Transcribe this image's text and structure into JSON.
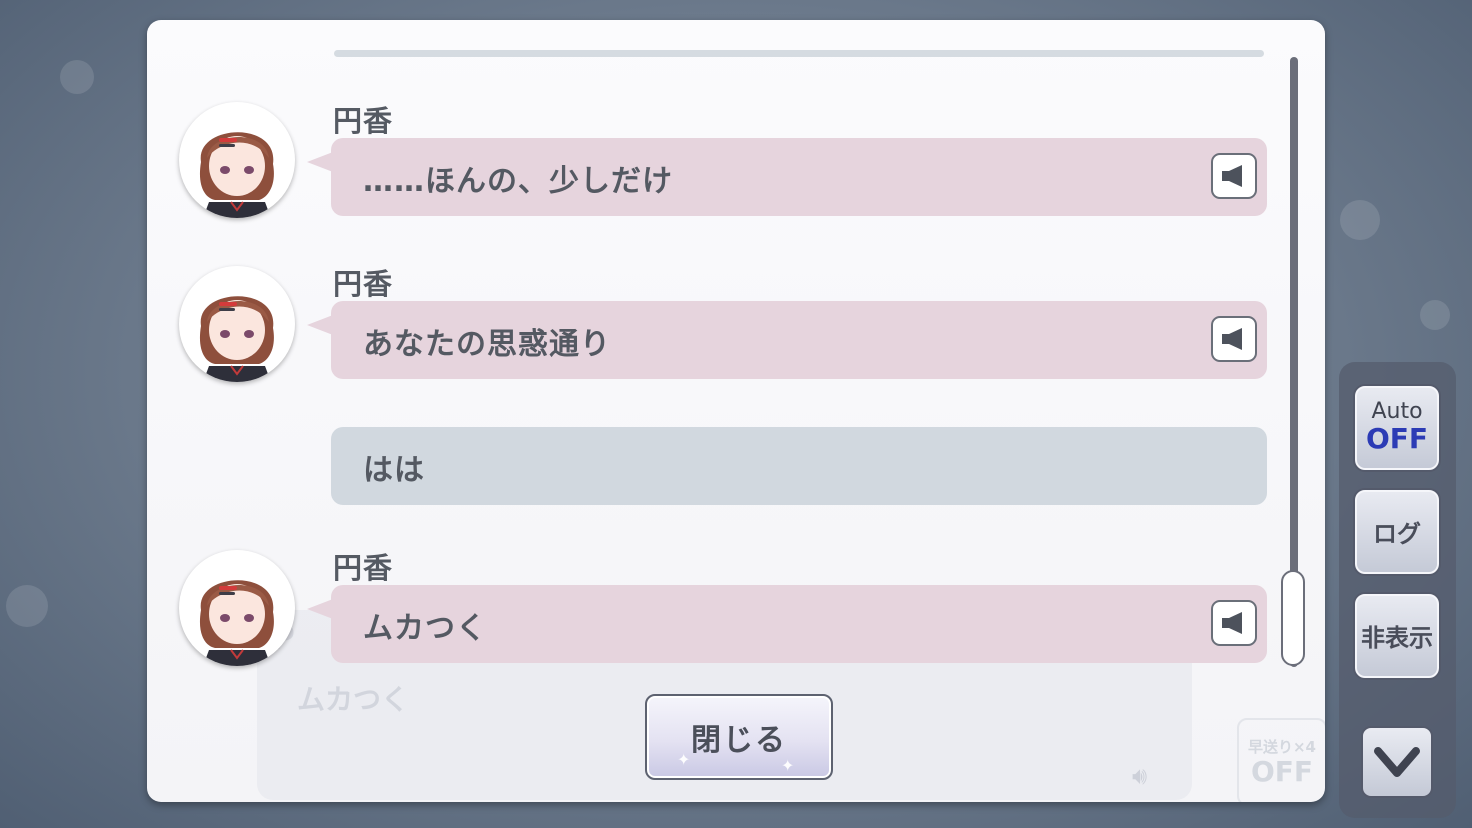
{
  "log": {
    "entries": [
      {
        "speaker": "円香",
        "text": "……ほんの、少しだけ",
        "has_voice": true,
        "avatar_icon": "madoka-avatar-icon"
      },
      {
        "speaker": "円香",
        "text": "あなたの思惑通り",
        "has_voice": true,
        "avatar_icon": "madoka-avatar-icon"
      },
      {
        "speaker": "",
        "text": "はは",
        "has_voice": false
      },
      {
        "speaker": "円香",
        "text": "ムカつく",
        "has_voice": true,
        "avatar_icon": "madoka-avatar-icon"
      }
    ],
    "close_label": "閉じる",
    "voice_icon": "speaker-icon"
  },
  "background_dialog": {
    "line": "ムカつく",
    "fast_forward_top": "早送り×4",
    "fast_forward_bottom": "OFF"
  },
  "side_controls": {
    "auto_top": "Auto",
    "auto_bottom": "OFF",
    "log_label": "ログ",
    "hide_label": "非表示",
    "down_icon": "chevron-down-icon"
  },
  "colors": {
    "character_bubble": "#e6d4dd",
    "protagonist_bubble": "#d1d8df",
    "auto_off": "#2c3bb5"
  }
}
